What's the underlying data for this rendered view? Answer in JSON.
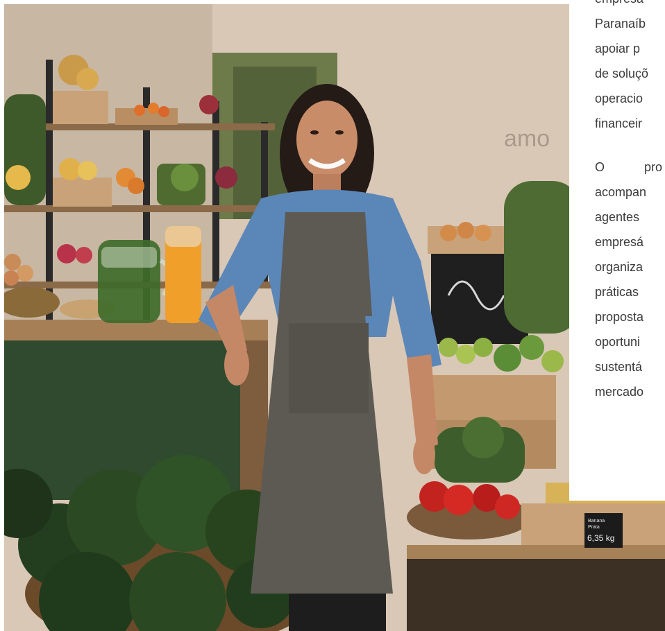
{
  "hero": {
    "image_name": "woman-in-apron-at-produce-shop",
    "wall_sign": "amo",
    "chalkboard_price": {
      "line1": "Banana",
      "line2": "Prata",
      "price": "6,35 kg"
    }
  },
  "article": {
    "paragraph1_lines": [
      "empresa",
      "Paranaíb",
      "apoiar p",
      "de soluçõ",
      "operacio",
      "financeir"
    ],
    "paragraph2_first_word": "O",
    "paragraph2_first_tail": "pro",
    "paragraph2_lines": [
      "acompan",
      "agentes",
      "empresá",
      "organiza",
      "práticas",
      "proposta",
      "oportuni",
      "sustentá",
      "mercado"
    ]
  }
}
